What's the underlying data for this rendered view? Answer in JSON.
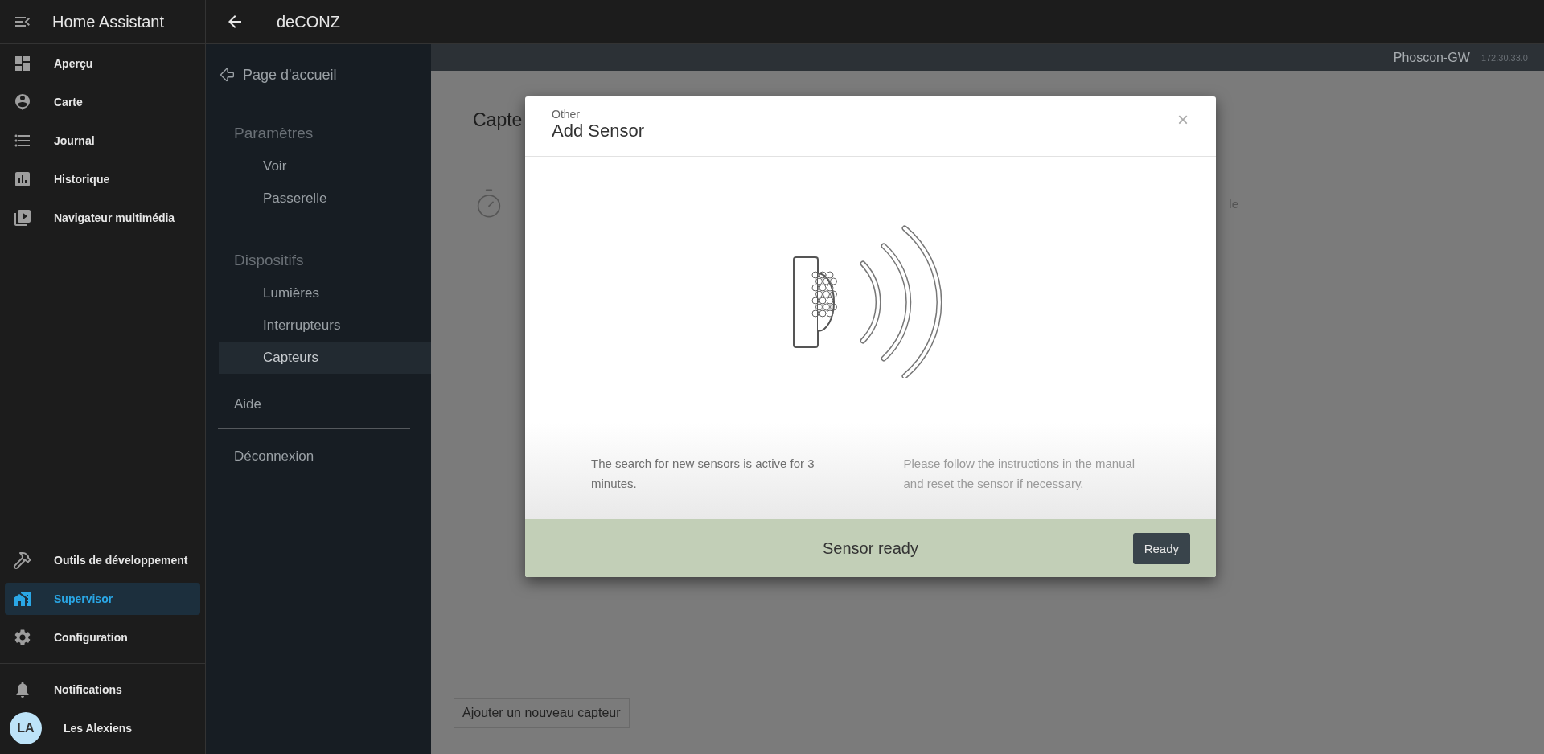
{
  "topbar": {
    "app_title": "Home Assistant",
    "page_title": "deCONZ"
  },
  "sidebar": {
    "items": [
      {
        "label": "Aperçu",
        "selected": false
      },
      {
        "label": "Carte",
        "selected": false
      },
      {
        "label": "Journal",
        "selected": false
      },
      {
        "label": "Historique",
        "selected": false
      },
      {
        "label": "Navigateur multimédia",
        "selected": false
      }
    ],
    "bottom_items": [
      {
        "label": "Outils de développement",
        "selected": false
      },
      {
        "label": "Supervisor",
        "selected": true
      },
      {
        "label": "Configuration",
        "selected": false
      }
    ],
    "notifications": "Notifications",
    "user": {
      "initials": "LA",
      "name": "Les Alexiens"
    }
  },
  "nav": {
    "home": "Page d'accueil",
    "sections": [
      {
        "heading": "Paramètres",
        "items": [
          {
            "label": "Voir",
            "selected": false
          },
          {
            "label": "Passerelle",
            "selected": false
          }
        ]
      },
      {
        "heading": "Dispositifs",
        "items": [
          {
            "label": "Lumières",
            "selected": false
          },
          {
            "label": "Interrupteurs",
            "selected": false
          },
          {
            "label": "Capteurs",
            "selected": true
          }
        ]
      }
    ],
    "help": "Aide",
    "logout": "Déconnexion"
  },
  "content": {
    "gateway_name": "Phoscon-GW",
    "gateway_ip": "172.30.33.0",
    "heading": "Capte",
    "side_text": "le",
    "add_button": "Ajouter un nouveau capteur"
  },
  "dialog": {
    "category": "Other",
    "title": "Add Sensor",
    "close": "×",
    "notes": [
      {
        "text": "The search for new sensors is active for 3 minutes.",
        "faded": false
      },
      {
        "text": "Please follow the instructions in the manual and reset the sensor if necessary.",
        "faded": true
      }
    ],
    "status": "Sensor ready",
    "button": "Ready"
  }
}
